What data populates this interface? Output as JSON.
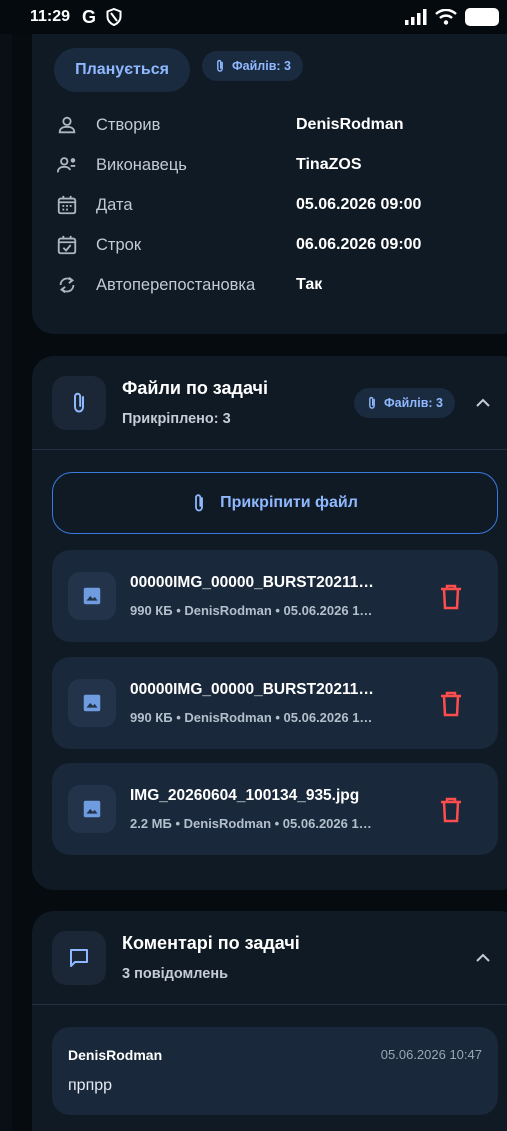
{
  "status_bar": {
    "time": "11:29",
    "g_letter": "G"
  },
  "task": {
    "status_label": "Планується",
    "files_badge": "Файлів: 3",
    "rows": [
      {
        "icon": "person-icon",
        "label": "Створив",
        "value": "DenisRodman"
      },
      {
        "icon": "assignee-icon",
        "label": "Виконавець",
        "value": "TinaZOS"
      },
      {
        "icon": "calendar-icon",
        "label": "Дата",
        "value": "05.06.2026 09:00"
      },
      {
        "icon": "calendar-check-icon",
        "label": "Строк",
        "value": "06.06.2026 09:00"
      },
      {
        "icon": "repeat-icon",
        "label": "Автоперепостановка",
        "value": "Так"
      }
    ]
  },
  "files_section": {
    "title": "Файли по задачі",
    "subtitle": "Прикріплено: 3",
    "files_badge": "Файлів: 3",
    "attach_label": "Прикріпити файл",
    "files": [
      {
        "name": "00000IMG_00000_BURST20211…",
        "meta": "990 КБ • DenisRodman • 05.06.2026 1…"
      },
      {
        "name": "00000IMG_00000_BURST20211…",
        "meta": "990 КБ • DenisRodman • 05.06.2026 1…"
      },
      {
        "name": "IMG_20260604_100134_935.jpg",
        "meta": "2.2 МБ • DenisRodman • 05.06.2026 1…"
      }
    ]
  },
  "comments_section": {
    "title": "Коментарі по задачі",
    "subtitle": "3 повідомлень",
    "comments": [
      {
        "author": "DenisRodman",
        "time": "05.06.2026 10:47",
        "text": "прпрр"
      }
    ]
  },
  "colors": {
    "accent": "#8fb8ff",
    "danger": "#ff4d4d",
    "card": "#0f1a24"
  }
}
